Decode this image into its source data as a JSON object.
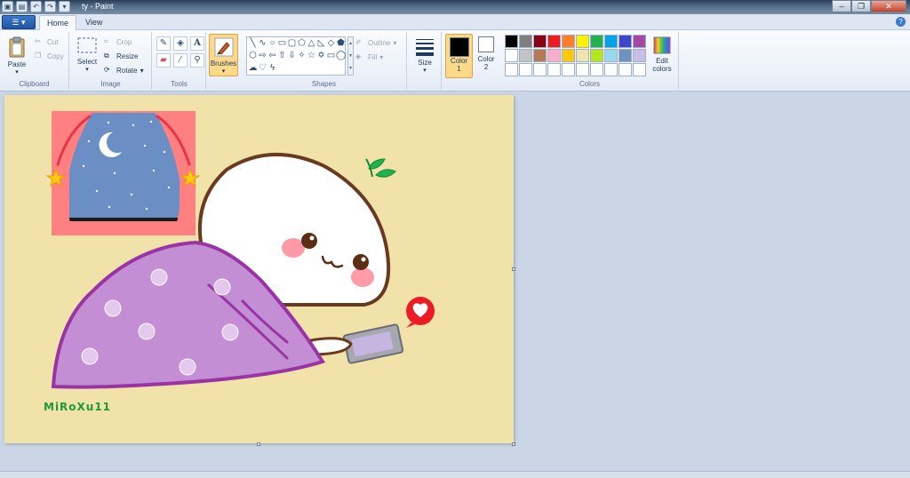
{
  "window": {
    "title": "ty - Paint"
  },
  "tabs": [
    {
      "label": "Home",
      "active": true
    },
    {
      "label": "View",
      "active": false
    }
  ],
  "clipboard": {
    "group_label": "Clipboard",
    "paste": "Paste",
    "cut": "Cut",
    "copy": "Copy"
  },
  "image": {
    "group_label": "Image",
    "select": "Select",
    "crop": "Crop",
    "resize": "Resize",
    "rotate": "Rotate"
  },
  "tools": {
    "group_label": "Tools",
    "items": [
      "pencil-icon",
      "fill-icon",
      "text-icon",
      "eraser-icon",
      "color-picker-icon",
      "magnifier-icon"
    ]
  },
  "brushes": {
    "label": "Brushes"
  },
  "shapes": {
    "group_label": "Shapes",
    "outline": "Outline",
    "fill": "Fill"
  },
  "size": {
    "label": "Size"
  },
  "colors": {
    "group_label": "Colors",
    "color1_label": "Color",
    "color1_index": "1",
    "color2_label": "Color",
    "color2_index": "2",
    "color1_value": "#000000",
    "color2_value": "#ffffff",
    "edit_label": "Edit",
    "edit_label2": "colors",
    "palette": [
      "#000000",
      "#7f7f7f",
      "#880015",
      "#ed1c24",
      "#ff7f27",
      "#fff200",
      "#22b14c",
      "#00a2e8",
      "#3f48cc",
      "#a349a4",
      "#ffffff",
      "#c3c3c3",
      "#b97a57",
      "#ffaec9",
      "#ffc90e",
      "#efe4b0",
      "#b5e61d",
      "#99d9ea",
      "#7092be",
      "#c8bfe7",
      "#ffffff",
      "#ffffff",
      "#ffffff",
      "#ffffff",
      "#ffffff",
      "#ffffff",
      "#ffffff",
      "#ffffff",
      "#ffffff",
      "#ffffff"
    ]
  },
  "canvas": {
    "signature": "MiRoXu11",
    "background": "#f0e2a9"
  }
}
